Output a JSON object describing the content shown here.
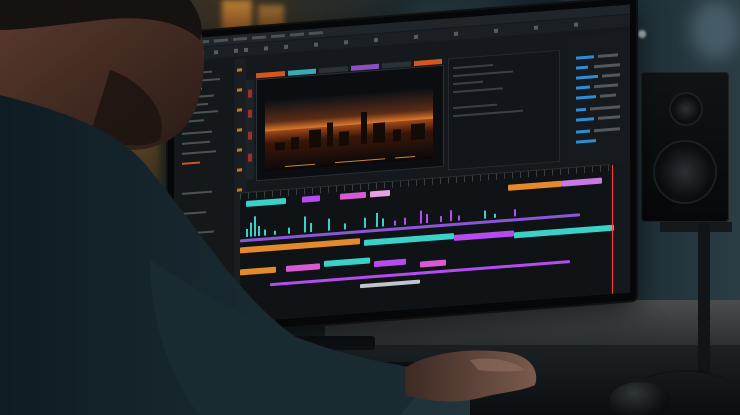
{
  "scene": {
    "type": "photo",
    "subject": "person-editing-video",
    "palette": {
      "timeline_teal": "#3ad1c9",
      "timeline_purple": "#b44cf0",
      "timeline_orange": "#e48a2c",
      "timeline_magenta": "#d85ad3",
      "ui_accent_blue": "#2b8dd6",
      "preview_sunset": "#e07a2c",
      "ambient_warm": "#d8913a"
    }
  },
  "editor": {
    "viewer": {
      "content": "night-city-skyline-at-sunset"
    },
    "timeline": {
      "video_tracks": 2,
      "audio_waveform_tracks": 1,
      "color_tracks": 5
    }
  }
}
